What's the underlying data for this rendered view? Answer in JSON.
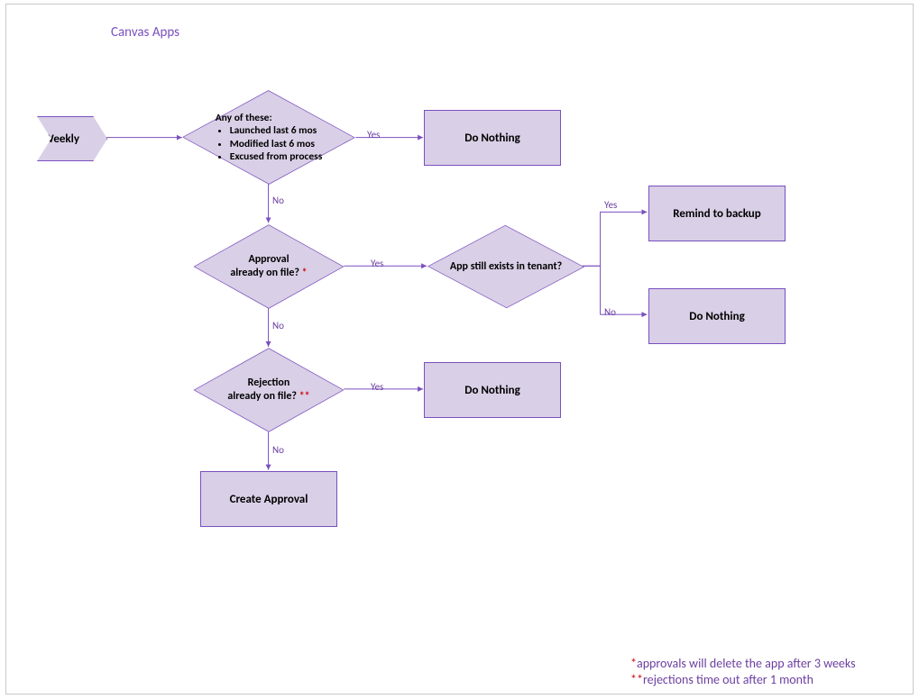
{
  "title": "Canvas Apps",
  "nodes": {
    "start": {
      "label": "Weekly"
    },
    "d1": {
      "header": "Any of these:",
      "items": [
        "Launched last 6 mos",
        "Modified last 6 mos",
        "Excused from process"
      ]
    },
    "r1": {
      "label": "Do Nothing"
    },
    "d2": {
      "line1": "Approval",
      "line2": "already on file? ",
      "mark": "*"
    },
    "d3": {
      "label": "App still exists in tenant?"
    },
    "r2": {
      "label": "Remind to backup"
    },
    "r3": {
      "label": "Do Nothing"
    },
    "d4": {
      "line1": "Rejection",
      "line2": "already on file? ",
      "mark": "**"
    },
    "r4": {
      "label": "Do Nothing"
    },
    "r5": {
      "label": "Create Approval"
    }
  },
  "edges": {
    "yes": "Yes",
    "no": "No"
  },
  "footnotes": {
    "f1_mark": "*",
    "f1_text": "approvals will delete the app after 3 weeks",
    "f2_mark": "**",
    "f2_text": "rejections time out after 1 month"
  },
  "colors": {
    "fill": "#d9cfe6",
    "stroke": "#7a4fc0"
  }
}
